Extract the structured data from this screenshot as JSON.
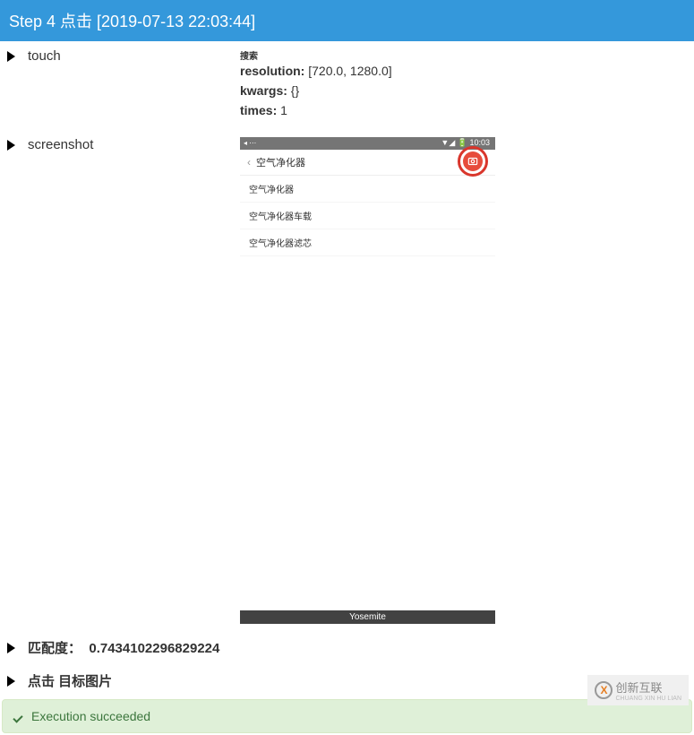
{
  "header": {
    "title": "Step 4 点击 [2019-07-13 22:03:44]"
  },
  "rows": {
    "touch": {
      "label": "touch",
      "small_label": "搜索",
      "resolution_label": "resolution:",
      "resolution_value": " [720.0, 1280.0]",
      "kwargs_label": "kwargs:",
      "kwargs_value": " {}",
      "times_label": "times:",
      "times_value": " 1"
    },
    "screenshot": {
      "label": "screenshot",
      "phone": {
        "status_time": "10:03",
        "status_signal": "▼◢ 🔋",
        "search_text": "空气净化器",
        "suggestions": [
          "空气净化器",
          "空气净化器车载",
          "空气净化器滤芯"
        ],
        "bottom_label": "Yosemite"
      }
    },
    "match": {
      "label": "匹配度：",
      "value": "0.7434102296829224"
    },
    "click_target": {
      "label": "点击 目标图片"
    }
  },
  "footer": {
    "success": "Execution succeeded"
  },
  "watermark": {
    "text": "创新互联",
    "sub": "CHUANG XIN HU LIAN",
    "logo": "X"
  }
}
